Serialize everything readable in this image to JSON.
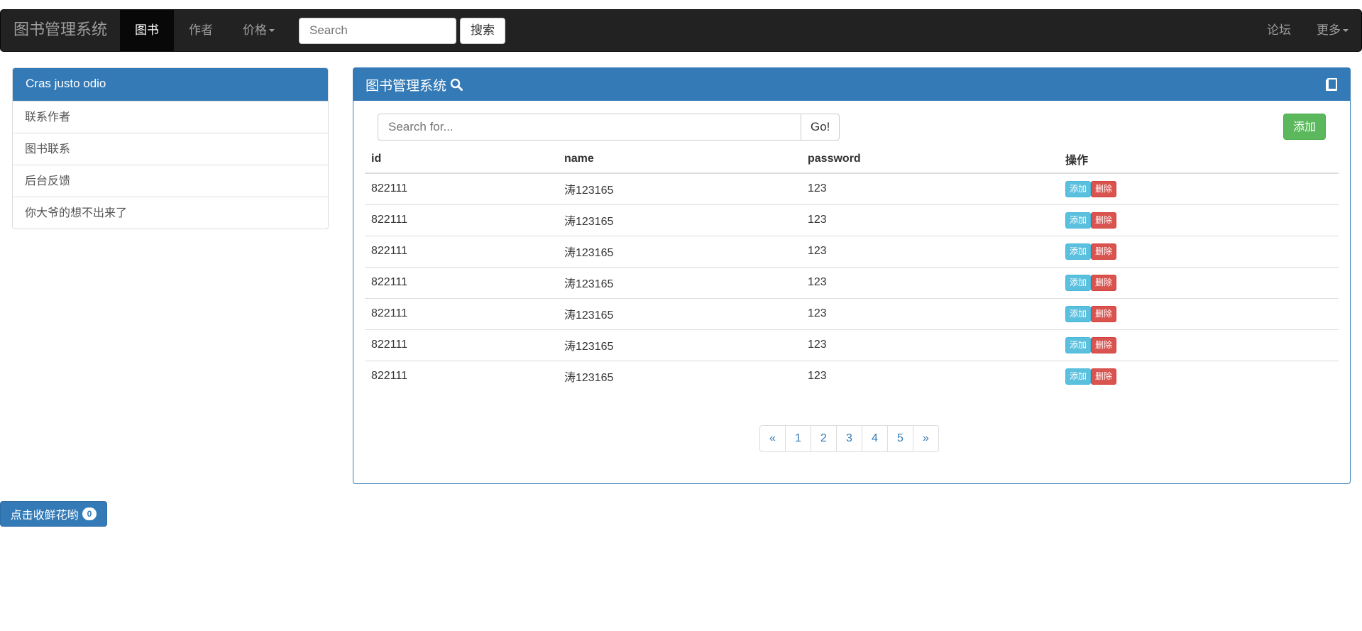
{
  "navbar": {
    "brand": "图书管理系统",
    "items": [
      "图书",
      "作者",
      "价格"
    ],
    "search_placeholder": "Search",
    "search_button": "搜索",
    "right_items": [
      "论坛",
      "更多"
    ]
  },
  "sidebar": {
    "heading": "Cras justo odio",
    "items": [
      "联系作者",
      "图书联系",
      "后台反馈",
      "你大爷的想不出来了"
    ]
  },
  "panel": {
    "title": "图书管理系统",
    "search_placeholder": "Search for...",
    "go_button": "Go!",
    "add_button": "添加",
    "columns": [
      "id",
      "name",
      "password",
      "操作"
    ],
    "rows": [
      {
        "id": "822111",
        "name": "涛123165",
        "password": "123"
      },
      {
        "id": "822111",
        "name": "涛123165",
        "password": "123"
      },
      {
        "id": "822111",
        "name": "涛123165",
        "password": "123"
      },
      {
        "id": "822111",
        "name": "涛123165",
        "password": "123"
      },
      {
        "id": "822111",
        "name": "涛123165",
        "password": "123"
      },
      {
        "id": "822111",
        "name": "涛123165",
        "password": "123"
      },
      {
        "id": "822111",
        "name": "涛123165",
        "password": "123"
      }
    ],
    "row_add_label": "添加",
    "row_delete_label": "删除",
    "pagination": [
      "«",
      "1",
      "2",
      "3",
      "4",
      "5",
      "»"
    ]
  },
  "flower_button": {
    "label": "点击收鲜花哟",
    "count": "0"
  },
  "colors": {
    "navbar_bg": "#222222",
    "primary": "#337ab7",
    "success": "#5cb85c",
    "info": "#5bc0de",
    "danger": "#d9534f"
  },
  "icons": {
    "panel_search": "search-icon",
    "panel_book": "book-icon"
  }
}
